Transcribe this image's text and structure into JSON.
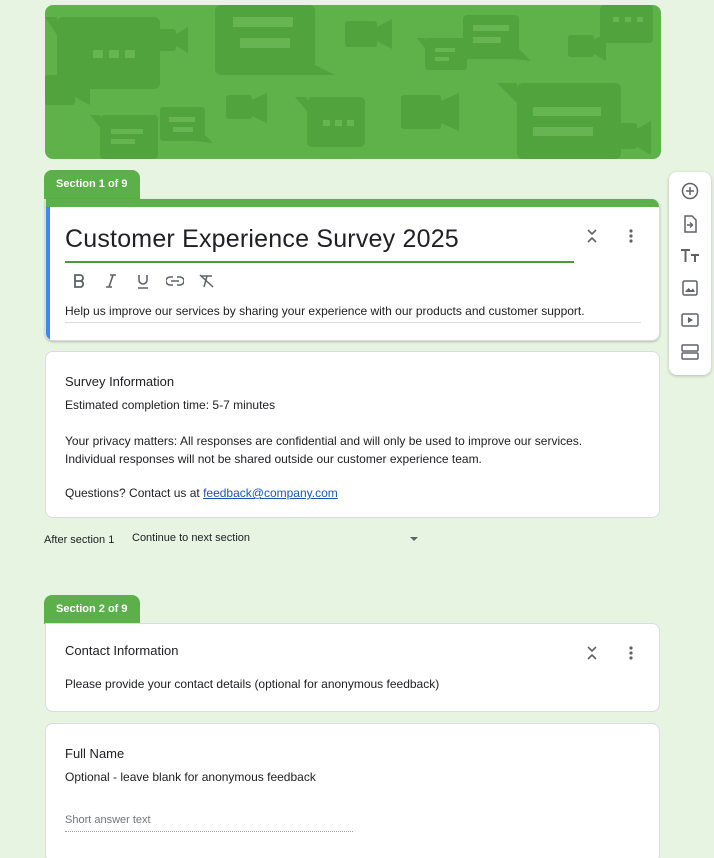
{
  "colors": {
    "accent": "#5cb04a",
    "banner": "#5fb14a",
    "link": "#1a57b5",
    "focus_strip": "#4285f4",
    "page_bg": "#e6f4e1"
  },
  "sections": [
    {
      "tab": "Section 1 of 9"
    },
    {
      "tab": "Section 2 of 9"
    }
  ],
  "form": {
    "title": "Customer Experience Survey 2025",
    "description": "Help us improve our services by sharing your experience with our products and customer support."
  },
  "formatting": [
    "bold-icon",
    "italic-icon",
    "underline-icon",
    "link-icon",
    "clear-format-icon"
  ],
  "toolbar": [
    "add-question-icon",
    "import-questions-icon",
    "add-title-icon",
    "add-image-icon",
    "add-video-icon",
    "add-section-icon"
  ],
  "info": {
    "heading": "Survey Information",
    "time": "Estimated completion time: 5-7 minutes",
    "privacy": "Your privacy matters: All responses are confidential and will only be used to improve our services. Individual responses will not be shared outside our customer experience team.",
    "contact_prefix": "Questions? Contact us at ",
    "contact_email": "feedback@company.com"
  },
  "after_section": {
    "label": "After section 1",
    "value": "Continue to next section"
  },
  "contact": {
    "heading": "Contact Information",
    "text": "Please provide your contact details (optional for anonymous feedback)"
  },
  "question": {
    "title": "Full Name",
    "description": "Optional - leave blank for anonymous feedback",
    "placeholder": "Short answer text"
  }
}
